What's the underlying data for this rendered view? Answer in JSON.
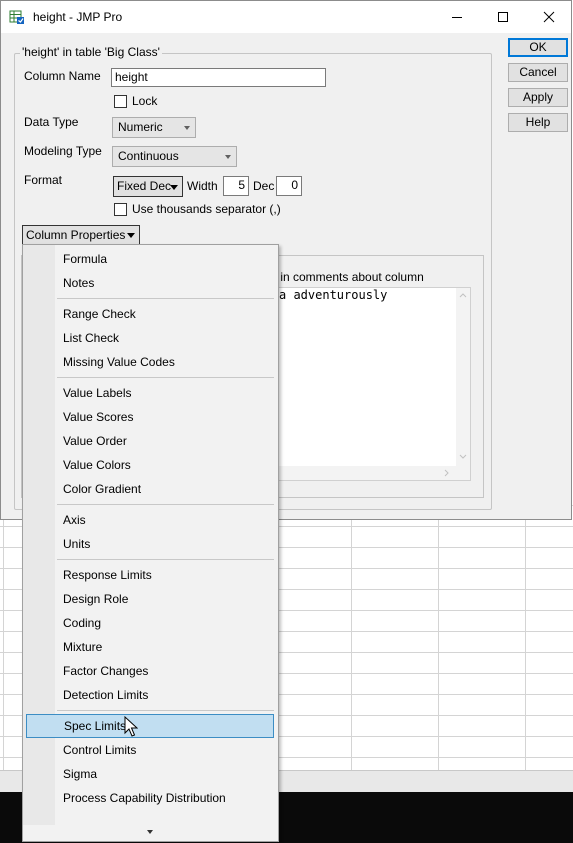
{
  "window": {
    "title": "height - JMP Pro",
    "controls": [
      "minimize",
      "maximize",
      "close"
    ]
  },
  "group": {
    "title": "'height' in table 'Big Class'"
  },
  "form": {
    "column_name_label": "Column Name",
    "column_name_value": "height",
    "lock_label": "Lock",
    "lock_checked": false,
    "data_type_label": "Data Type",
    "data_type_value": "Numeric",
    "modeling_type_label": "Modeling Type",
    "modeling_type_value": "Continuous",
    "format_label": "Format",
    "format_value": "Fixed Dec",
    "width_label": "Width",
    "width_value": "5",
    "dec_label": "Dec",
    "dec_value": "0",
    "thousands_label": "Use thousands separator (,)",
    "thousands_checked": false,
    "column_properties_label": "Column Properties"
  },
  "buttons": {
    "ok": "OK",
    "cancel": "Cancel",
    "apply": "Apply",
    "help": "Help"
  },
  "notes": {
    "hint": "y in comments about column",
    "text": "a adventurously"
  },
  "menu": {
    "groups": [
      [
        "Formula",
        "Notes"
      ],
      [
        "Range Check",
        "List Check",
        "Missing Value Codes"
      ],
      [
        "Value Labels",
        "Value Scores",
        "Value Order",
        "Value Colors",
        "Color Gradient"
      ],
      [
        "Axis",
        "Units"
      ],
      [
        "Response Limits",
        "Design Role",
        "Coding",
        "Mixture",
        "Factor Changes",
        "Detection Limits"
      ],
      [
        "Spec Limits",
        "Control Limits",
        "Sigma",
        "Process Capability Distribution"
      ]
    ],
    "highlighted": "Spec Limits"
  }
}
